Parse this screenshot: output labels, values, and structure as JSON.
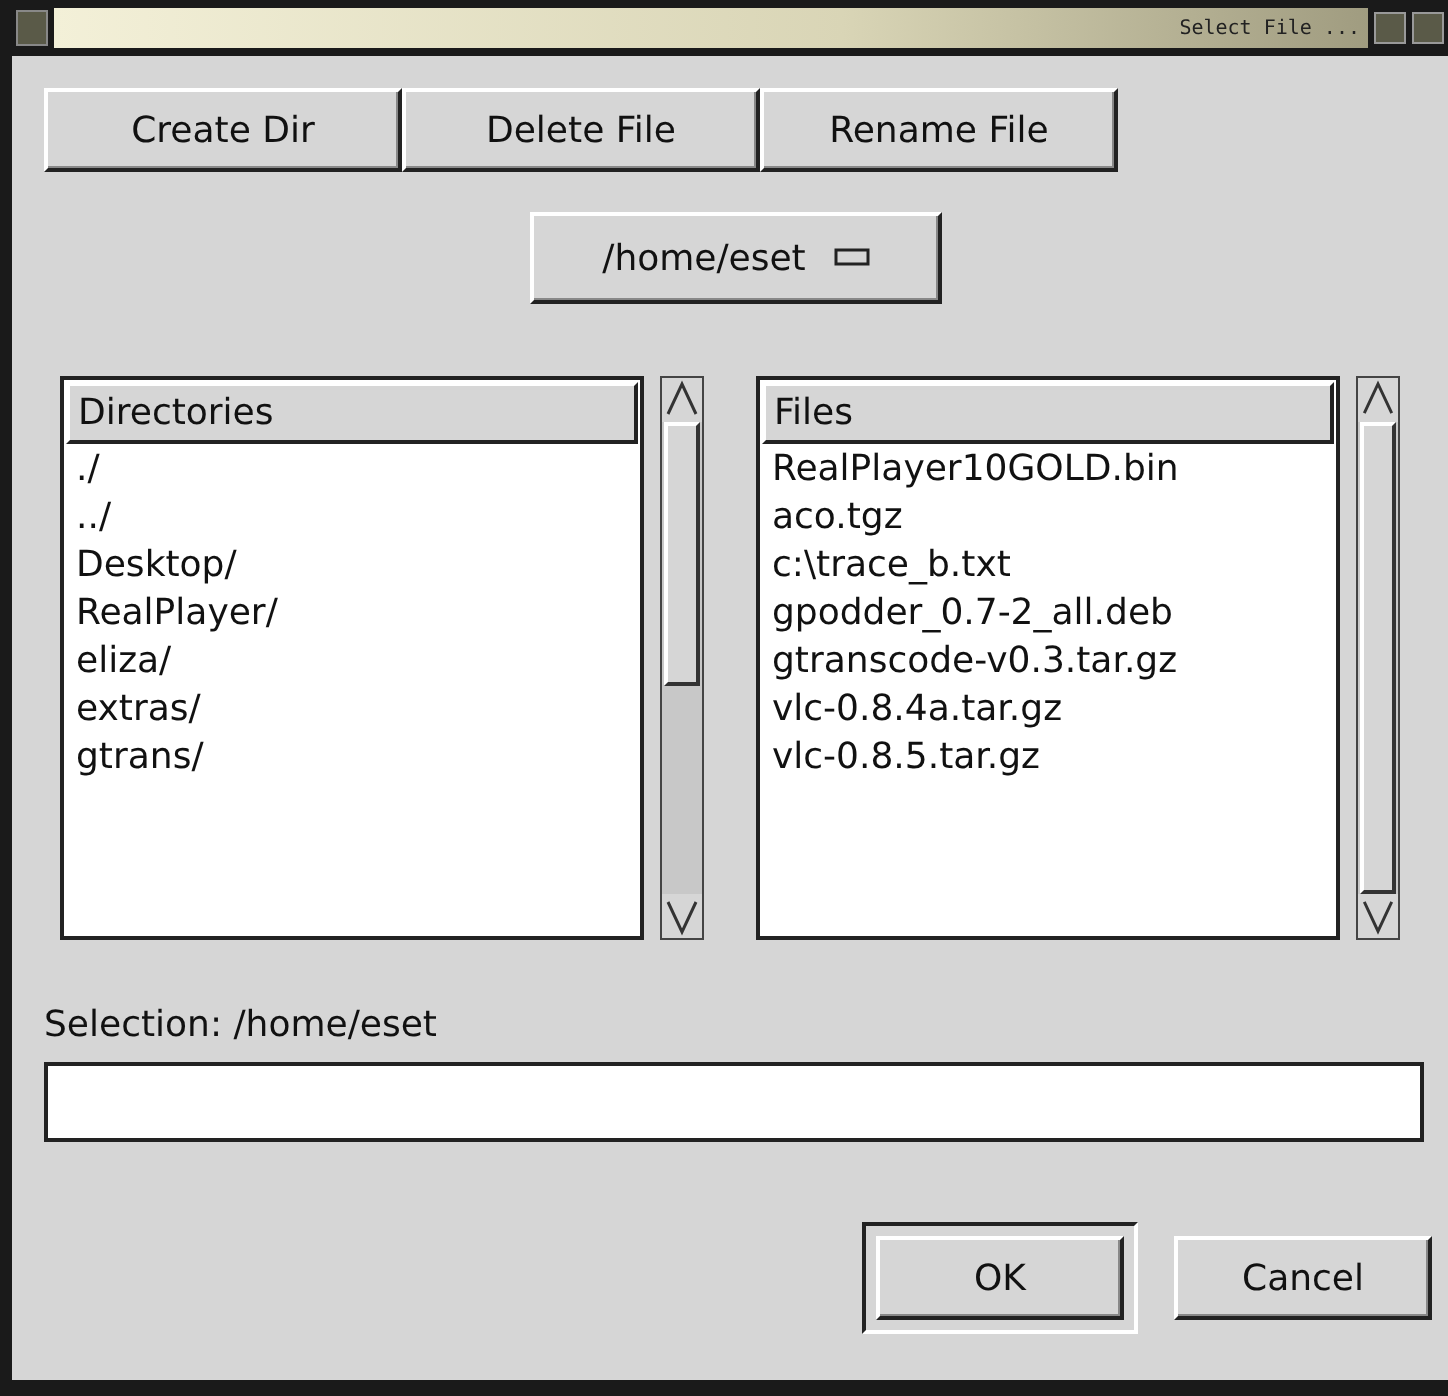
{
  "window": {
    "title": "Select File ..."
  },
  "toolbar": {
    "buttons": [
      "Create Dir",
      "Delete File",
      "Rename File"
    ]
  },
  "path_menu": {
    "value": "/home/eset"
  },
  "directories": {
    "header": "Directories",
    "items": [
      "./",
      "../",
      "Desktop/",
      "RealPlayer/",
      "eliza/",
      "extras/",
      "gtrans/"
    ]
  },
  "files": {
    "header": "Files",
    "items": [
      "RealPlayer10GOLD.bin",
      "aco.tgz",
      "c:\\trace_b.txt",
      "gpodder_0.7-2_all.deb",
      "gtranscode-v0.3.tar.gz",
      "vlc-0.8.4a.tar.gz",
      "vlc-0.8.5.tar.gz"
    ]
  },
  "selection": {
    "label": "Selection: /home/eset"
  },
  "buttons": [
    {
      "label": "OK",
      "default": true
    },
    {
      "label": "Cancel",
      "default": false
    }
  ]
}
